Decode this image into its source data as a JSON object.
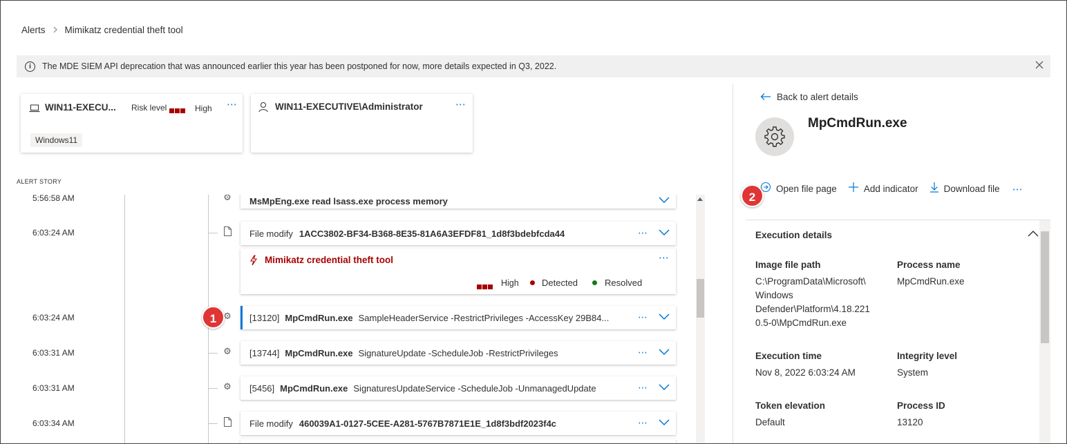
{
  "breadcrumb": {
    "parent": "Alerts",
    "separator": ">",
    "current": "Mimikatz credential theft tool"
  },
  "banner": {
    "text": "The MDE SIEM API deprecation that was announced earlier this year has been postponed for now, more details expected in Q3, 2022."
  },
  "device_card": {
    "name": "WIN11-EXECU...",
    "risk_label": "Risk level",
    "risk_value": "High",
    "tag": "Windows11"
  },
  "user_card": {
    "name": "WIN11-EXECUTIVE\\Administrator"
  },
  "story": {
    "label": "ALERT STORY",
    "events": [
      {
        "time": "5:56:58 AM",
        "title": "MsMpEng.exe read lsass.exe process memory"
      },
      {
        "time": "6:03:24 AM",
        "label": "File modify",
        "title": "1ACC3802-BF34-B368-8E35-81A6A3EFDF81_1d8f3bdebfcda44"
      },
      {
        "time": "6:03:24 AM",
        "pid": "[13120]",
        "title": "MpCmdRun.exe",
        "args": "SampleHeaderService -RestrictPrivileges -AccessKey 29B84..."
      },
      {
        "time": "6:03:31 AM",
        "pid": "[13744]",
        "title": "MpCmdRun.exe",
        "args": "SignatureUpdate -ScheduleJob -RestrictPrivileges"
      },
      {
        "time": "6:03:31 AM",
        "pid": "[5456]",
        "title": "MpCmdRun.exe",
        "args": "SignaturesUpdateService -ScheduleJob -UnmanagedUpdate"
      },
      {
        "time": "6:03:34 AM",
        "label": "File modify",
        "title": "460039A1-0127-5CEE-A281-5767B7871E1E_1d8f3bdf2023f4c"
      }
    ],
    "alert": {
      "title": "Mimikatz credential theft tool",
      "severity": "High",
      "status1": "Detected",
      "status2": "Resolved"
    }
  },
  "markers": {
    "m1": "1",
    "m2": "2"
  },
  "panel": {
    "back": "Back to alert details",
    "file_name": "MpCmdRun.exe",
    "actions": {
      "open": "Open file page",
      "add": "Add indicator",
      "download": "Download file"
    },
    "section_title": "Execution details",
    "details": {
      "image_path_label": "Image file path",
      "image_path_lines": [
        "C:\\ProgramData\\Microsoft\\",
        "Windows",
        "Defender\\Platform\\4.18.221",
        "0.5-0\\MpCmdRun.exe"
      ],
      "process_name_label": "Process name",
      "process_name": "MpCmdRun.exe",
      "exec_time_label": "Execution time",
      "exec_time": "Nov 8, 2022 6:03:24 AM",
      "integrity_label": "Integrity level",
      "integrity": "System",
      "token_label": "Token elevation",
      "token": "Default",
      "pid_label": "Process ID",
      "pid": "13120"
    }
  },
  "colors": {
    "accent": "#0078d4",
    "severity": "#a80000",
    "marker": "#e03535",
    "resolved": "#107c10"
  },
  "icons": {
    "info": "info-icon",
    "close": "close-icon",
    "laptop": "laptop-icon",
    "user": "user-icon",
    "gear": "gear-icon",
    "file": "file-icon",
    "alert": "lightning-icon"
  }
}
